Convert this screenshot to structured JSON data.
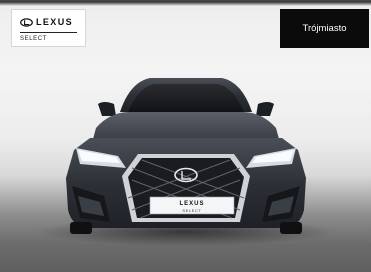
{
  "branding": {
    "logo_text": "LEXUS",
    "logo_subtitle": "SELECT",
    "logo_icon": "lexus-emblem-icon"
  },
  "location_badge": {
    "label": "Trójmiasto"
  },
  "photo": {
    "subject": "Lexus ES sedan front view",
    "plate_text": "LEXUS",
    "plate_subtext": "SELECT",
    "colors": {
      "body": "#2f333a",
      "background": "#f2f2f2",
      "floor": "#6a6a6a",
      "badge": "#0b0b0b"
    }
  }
}
